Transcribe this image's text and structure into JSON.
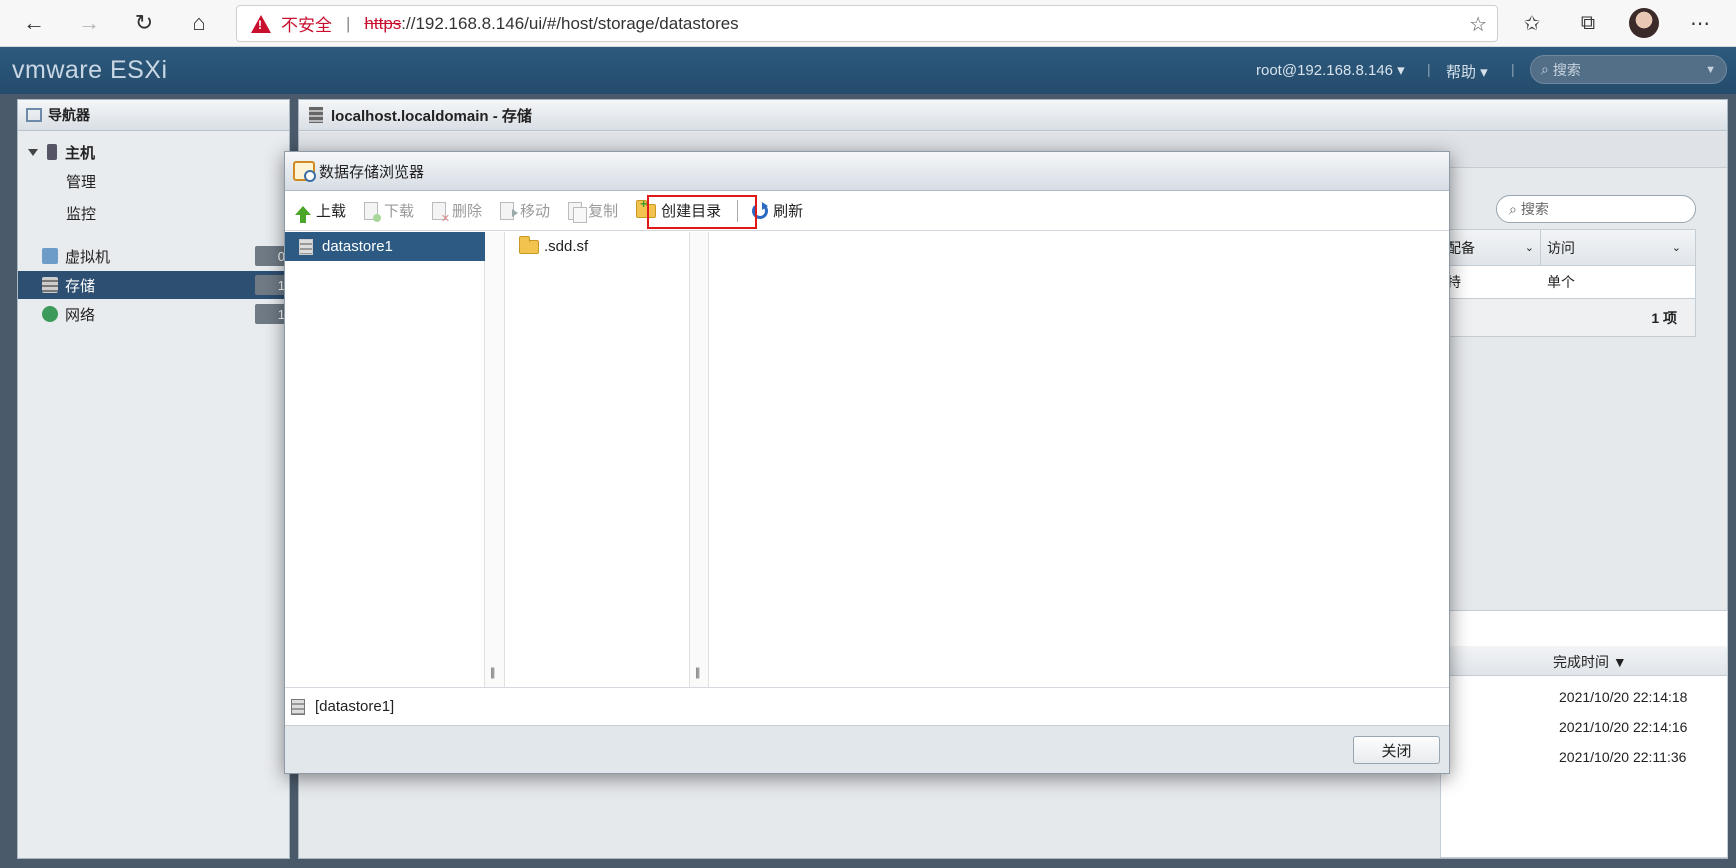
{
  "browser": {
    "insecure_label": "不安全",
    "url_scheme": "https",
    "url_rest": "://192.168.8.146/ui/#/host/storage/datastores",
    "icons": [
      "back-icon",
      "forward-icon",
      "reload-icon",
      "home-icon",
      "warning-icon",
      "add-favorite-icon",
      "favorites-icon",
      "collections-icon",
      "profile-avatar",
      "more-icon"
    ]
  },
  "esxi_header": {
    "brand": "vmware ESXi",
    "user": "root@192.168.8.146",
    "help": "帮助",
    "search_placeholder": "搜索"
  },
  "navigator": {
    "title": "导航器",
    "host": "主机",
    "host_children": [
      "管理",
      "监控"
    ],
    "items": [
      {
        "label": "虚拟机",
        "count": "0"
      },
      {
        "label": "存储",
        "count": "1"
      },
      {
        "label": "网络",
        "count": "1"
      }
    ]
  },
  "main": {
    "title": "localhost.localdomain - 存储",
    "search_placeholder": "搜索",
    "table": {
      "headers": [
        "配备",
        "访问"
      ],
      "row": [
        "持",
        "单个"
      ],
      "footer": "1 项"
    },
    "tasks": {
      "headers": [
        "完成时间 ▼"
      ],
      "rows": [
        "2021/10/20 22:14:18",
        "2021/10/20 22:14:16",
        "2021/10/20 22:11:36"
      ]
    }
  },
  "dialog": {
    "title": "数据存储浏览器",
    "toolbar": {
      "upload": "上载",
      "download": "下载",
      "delete": "删除",
      "move": "移动",
      "copy": "复制",
      "mkdir": "创建目录",
      "refresh": "刷新"
    },
    "datastore": "datastore1",
    "folder": ".sdd.sf",
    "path": "[datastore1]",
    "close": "关闭"
  }
}
